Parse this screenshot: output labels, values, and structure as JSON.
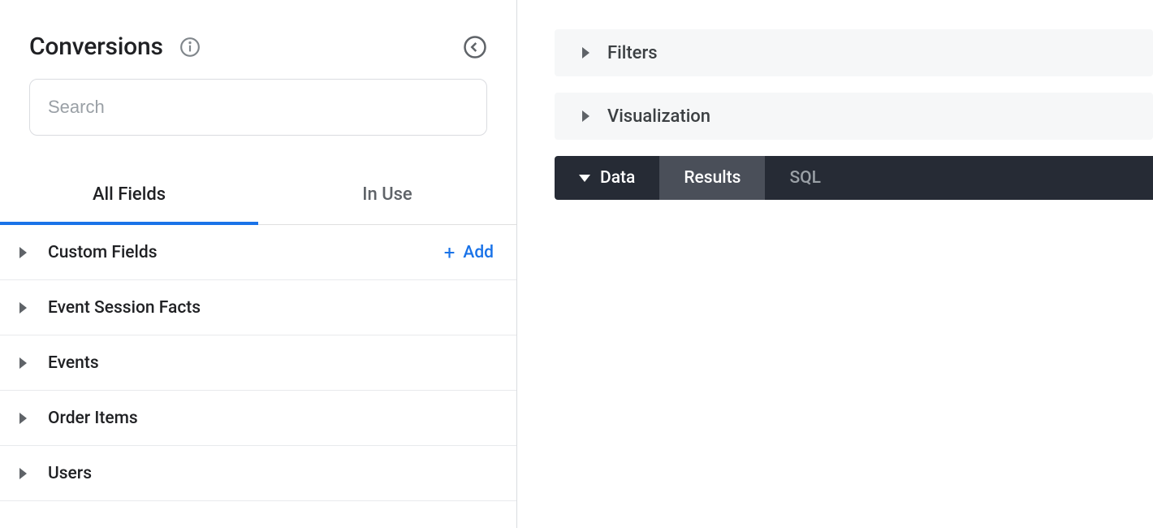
{
  "sidebar": {
    "title": "Conversions",
    "search_placeholder": "Search",
    "tabs": [
      {
        "label": "All Fields",
        "active": true
      },
      {
        "label": "In Use",
        "active": false
      }
    ],
    "add_label": "Add",
    "fields": [
      {
        "label": "Custom Fields",
        "has_add": true
      },
      {
        "label": "Event Session Facts"
      },
      {
        "label": "Events"
      },
      {
        "label": "Order Items"
      },
      {
        "label": "Users"
      }
    ]
  },
  "main": {
    "sections": [
      {
        "label": "Filters"
      },
      {
        "label": "Visualization"
      }
    ],
    "data_tabs": [
      {
        "label": "Data",
        "kind": "primary"
      },
      {
        "label": "Results",
        "kind": "results"
      },
      {
        "label": "SQL",
        "kind": "sql"
      }
    ]
  }
}
